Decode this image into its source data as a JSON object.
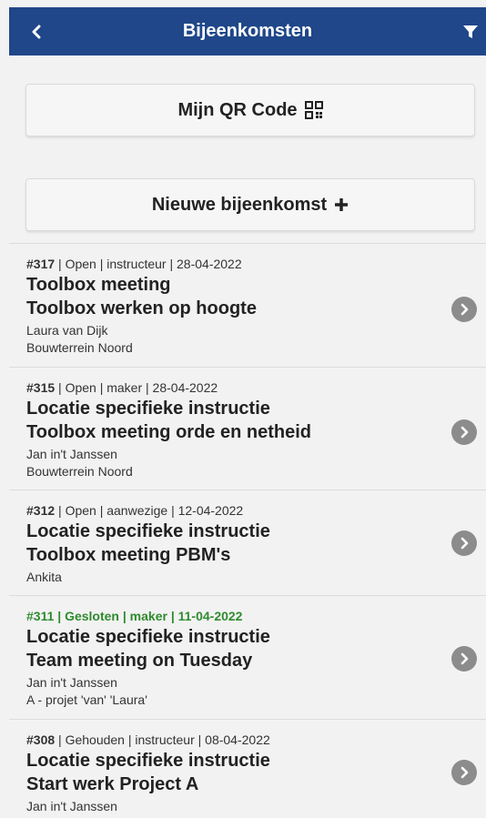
{
  "header": {
    "title": "Bijeenkomsten",
    "back_icon": "chevron-left-icon",
    "filter_icon": "filter-icon",
    "color": "#1f4789"
  },
  "buttons": {
    "qr_label": "Mijn QR Code",
    "new_label": "Nieuwe bijeenkomst"
  },
  "meetings": [
    {
      "id": "#317",
      "rest": " | Open | instructeur | 28-04-2022",
      "title1": "Toolbox meeting",
      "title2": "Toolbox werken op hoogte",
      "person": "Laura van Dijk",
      "location": "Bouwterrein Noord"
    },
    {
      "id": "#315",
      "rest": " | Open | maker | 28-04-2022",
      "title1": "Locatie specifieke instructie",
      "title2": "Toolbox meeting orde en netheid",
      "person": "Jan in't Janssen",
      "location": "Bouwterrein Noord"
    },
    {
      "id": "#312",
      "rest": " | Open | aanwezige | 12-04-2022",
      "title1": "Locatie specifieke instructie",
      "title2": "Toolbox meeting PBM's",
      "person": "Ankita"
    },
    {
      "meta": "#311 | Gesloten | maker | 11-04-2022",
      "title1": "Locatie specifieke instructie",
      "title2": "Team meeting on Tuesday",
      "person": "Jan in't Janssen",
      "location": "A - projet 'van' 'Laura'",
      "status_color": "#2e8b2e"
    },
    {
      "id": "#308",
      "rest": " | Gehouden | instructeur | 08-04-2022",
      "title1": "Locatie specifieke instructie",
      "title2": "Start werk Project A",
      "person": "Jan in't Janssen"
    }
  ]
}
